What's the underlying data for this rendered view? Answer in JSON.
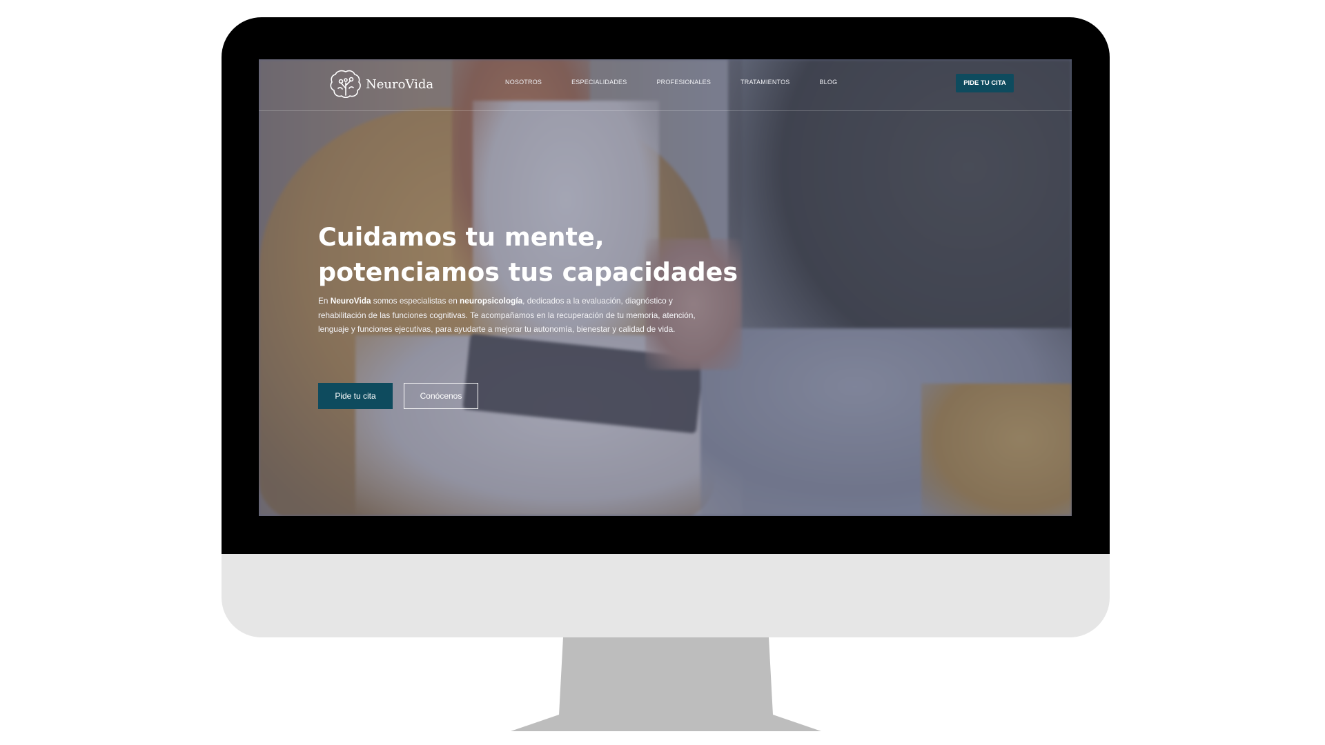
{
  "site": {
    "brand_name": "NeuroVida",
    "accent_color": "#0e4b5e",
    "logo_icon": "brain-tree-icon"
  },
  "nav": {
    "links": [
      "NOSOTROS",
      "ESPECIALIDADES",
      "PROFESIONALES",
      "TRATAMIENTOS",
      "BLOG"
    ],
    "cta_label": "PIDE TU CITA"
  },
  "hero": {
    "title_line_1": "Cuidamos tu mente,",
    "title_line_2": "potenciamos tus capacidades",
    "text": {
      "p1": "En ",
      "brand": "NeuroVida",
      "p2": " somos especialistas en ",
      "specialty": "neuropsicología",
      "p3": ", dedicados a la evaluación, diagnóstico y rehabilitación de las funciones cognitivas. Te acompañamos en la recuperación de tu memoria, atención, lenguaje y funciones ejecutivas, para ayudarte a mejorar tu autonomía, bienestar y calidad de vida."
    },
    "primary_button": "Pide tu cita",
    "secondary_button": "Conócenos"
  }
}
